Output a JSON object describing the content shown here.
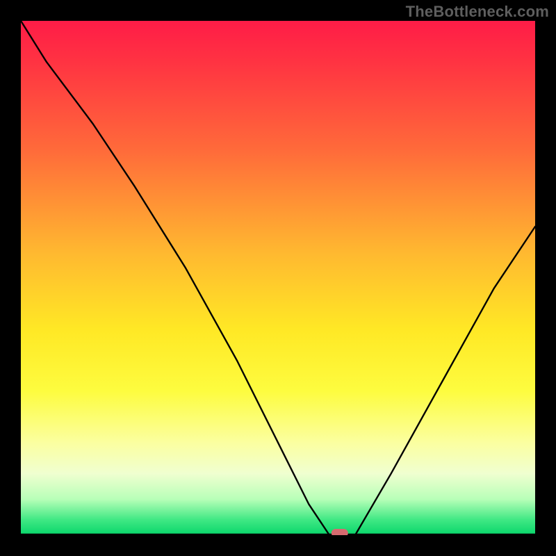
{
  "watermark": "TheBottleneck.com",
  "colors": {
    "frame_bg": "#000000",
    "watermark_text": "#5e5e5e",
    "curve_stroke": "#000000",
    "marker_fill": "#d66a6f",
    "gradient_top": "#ff1c47",
    "gradient_bottom": "#07d56a"
  },
  "chart_data": {
    "type": "line",
    "title": "",
    "xlabel": "",
    "ylabel": "",
    "x_range": [
      0,
      100
    ],
    "y_range": [
      0,
      100
    ],
    "description": "V-shaped bottleneck curve over red→yellow→green vertical gradient; minimum flat segment around x≈60–65; marker at approximate minimum.",
    "series": [
      {
        "name": "bottleneck-curve",
        "x": [
          0,
          5,
          14,
          22,
          32,
          42,
          50,
          56,
          60,
          65,
          72,
          82,
          92,
          100
        ],
        "y_percent": [
          100,
          92,
          80,
          68,
          52,
          34,
          18,
          6,
          0,
          0,
          12,
          30,
          48,
          60
        ]
      }
    ],
    "marker": {
      "x": 62,
      "y_percent": 0
    },
    "baseline_y_percent": 0
  }
}
